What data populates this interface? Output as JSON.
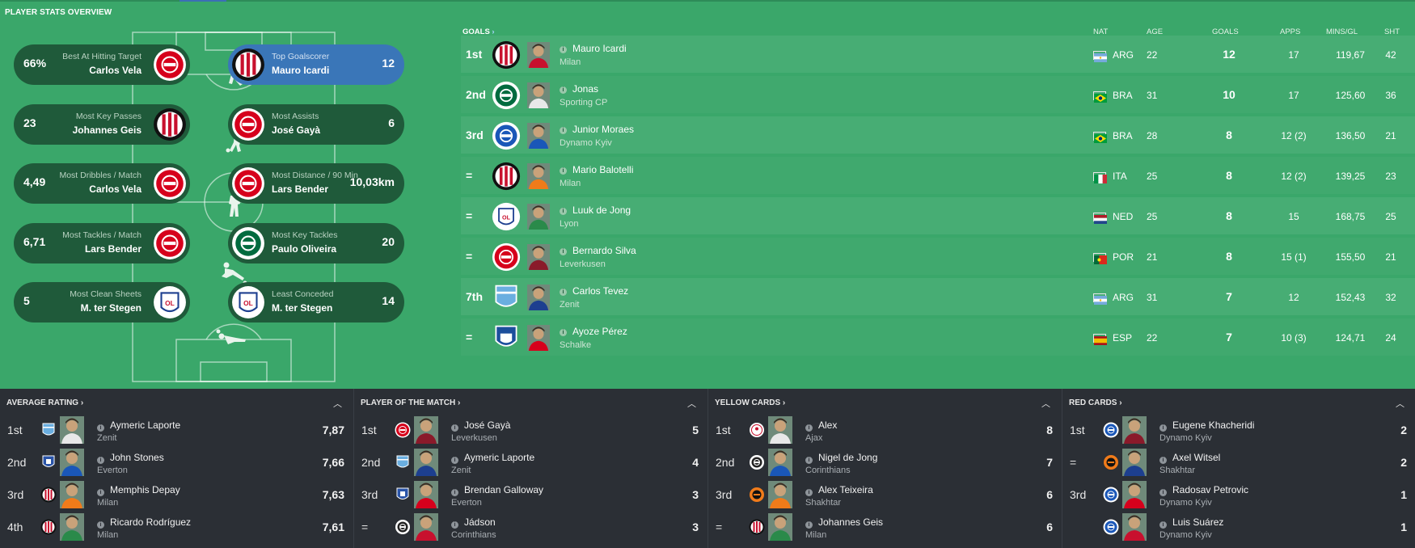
{
  "header": {
    "title": "PLAYER STATS OVERVIEW"
  },
  "stat_cards": [
    {
      "value": "66%",
      "caption": "Best At Hitting Target",
      "player": "Carlos Vela",
      "side": "left",
      "club": "leverkusen"
    },
    {
      "value": "12",
      "caption": "Top Goalscorer",
      "player": "Mauro Icardi",
      "side": "right",
      "club": "milan",
      "highlight": true
    },
    {
      "value": "23",
      "caption": "Most Key Passes",
      "player": "Johannes Geis",
      "side": "left",
      "club": "milan"
    },
    {
      "value": "6",
      "caption": "Most Assists",
      "player": "José Gayà",
      "side": "right",
      "club": "leverkusen"
    },
    {
      "value": "4,49",
      "caption": "Most Dribbles / Match",
      "player": "Carlos Vela",
      "side": "left",
      "club": "leverkusen"
    },
    {
      "value": "10,03km",
      "caption": "Most Distance / 90 Min",
      "player": "Lars Bender",
      "side": "right",
      "club": "leverkusen"
    },
    {
      "value": "6,71",
      "caption": "Most Tackles / Match",
      "player": "Lars Bender",
      "side": "left",
      "club": "leverkusen"
    },
    {
      "value": "20",
      "caption": "Most Key Tackles",
      "player": "Paulo Oliveira",
      "side": "right",
      "club": "sporting"
    },
    {
      "value": "5",
      "caption": "Most Clean Sheets",
      "player": "M. ter Stegen",
      "side": "left",
      "club": "lyon"
    },
    {
      "value": "14",
      "caption": "Least Conceded",
      "player": "M. ter Stegen",
      "side": "right",
      "club": "lyon"
    }
  ],
  "goals_table": {
    "title": "GOALS",
    "columns": {
      "nat": "NAT",
      "age": "AGE",
      "goals": "GOALS",
      "apps": "APPS",
      "mins_gl": "MINS/GL",
      "sht": "SHT"
    },
    "rows": [
      {
        "pos": "1st",
        "name": "Mauro Icardi",
        "club": "Milan",
        "nat": "ARG",
        "age": "22",
        "goals": "12",
        "apps": "17",
        "mins_gl": "119,67",
        "sht": "42",
        "badge": "milan",
        "flag": "arg"
      },
      {
        "pos": "2nd",
        "name": "Jonas",
        "club": "Sporting CP",
        "nat": "BRA",
        "age": "31",
        "goals": "10",
        "apps": "17",
        "mins_gl": "125,60",
        "sht": "36",
        "badge": "sporting",
        "flag": "bra"
      },
      {
        "pos": "3rd",
        "name": "Junior Moraes",
        "club": "Dynamo Kyiv",
        "nat": "BRA",
        "age": "28",
        "goals": "8",
        "apps": "12 (2)",
        "mins_gl": "136,50",
        "sht": "21",
        "badge": "dynamo",
        "flag": "bra"
      },
      {
        "pos": "=",
        "name": "Mario Balotelli",
        "club": "Milan",
        "nat": "ITA",
        "age": "25",
        "goals": "8",
        "apps": "12 (2)",
        "mins_gl": "139,25",
        "sht": "23",
        "badge": "milan",
        "flag": "ita"
      },
      {
        "pos": "=",
        "name": "Luuk de Jong",
        "club": "Lyon",
        "nat": "NED",
        "age": "25",
        "goals": "8",
        "apps": "15",
        "mins_gl": "168,75",
        "sht": "25",
        "badge": "lyon",
        "flag": "ned"
      },
      {
        "pos": "=",
        "name": "Bernardo Silva",
        "club": "Leverkusen",
        "nat": "POR",
        "age": "21",
        "goals": "8",
        "apps": "15 (1)",
        "mins_gl": "155,50",
        "sht": "21",
        "badge": "leverkusen",
        "flag": "por"
      },
      {
        "pos": "7th",
        "name": "Carlos Tevez",
        "club": "Zenit",
        "nat": "ARG",
        "age": "31",
        "goals": "7",
        "apps": "12",
        "mins_gl": "152,43",
        "sht": "32",
        "badge": "zenit",
        "flag": "arg"
      },
      {
        "pos": "=",
        "name": "Ayoze Pérez",
        "club": "Schalke",
        "nat": "ESP",
        "age": "22",
        "goals": "7",
        "apps": "10 (3)",
        "mins_gl": "124,71",
        "sht": "24",
        "badge": "schalke",
        "flag": "esp"
      }
    ]
  },
  "panels": [
    {
      "title": "AVERAGE RATING",
      "rows": [
        {
          "pos": "1st",
          "name": "Aymeric Laporte",
          "club": "Zenit",
          "value": "7,87",
          "badge": "zenit"
        },
        {
          "pos": "2nd",
          "name": "John Stones",
          "club": "Everton",
          "value": "7,66",
          "badge": "everton"
        },
        {
          "pos": "3rd",
          "name": "Memphis Depay",
          "club": "Milan",
          "value": "7,63",
          "badge": "milan"
        },
        {
          "pos": "4th",
          "name": "Ricardo Rodríguez",
          "club": "Milan",
          "value": "7,61",
          "badge": "milan"
        }
      ]
    },
    {
      "title": "PLAYER OF THE MATCH",
      "rows": [
        {
          "pos": "1st",
          "name": "José Gayà",
          "club": "Leverkusen",
          "value": "5",
          "badge": "leverkusen"
        },
        {
          "pos": "2nd",
          "name": "Aymeric Laporte",
          "club": "Zenit",
          "value": "4",
          "badge": "zenit"
        },
        {
          "pos": "3rd",
          "name": "Brendan Galloway",
          "club": "Everton",
          "value": "3",
          "badge": "everton"
        },
        {
          "pos": "=",
          "name": "Jádson",
          "club": "Corinthians",
          "value": "3",
          "badge": "corinthians"
        }
      ]
    },
    {
      "title": "YELLOW CARDS",
      "rows": [
        {
          "pos": "1st",
          "name": "Alex",
          "club": "Ajax",
          "value": "8",
          "badge": "ajax"
        },
        {
          "pos": "2nd",
          "name": "Nigel de Jong",
          "club": "Corinthians",
          "value": "7",
          "badge": "corinthians"
        },
        {
          "pos": "3rd",
          "name": "Alex Teixeira",
          "club": "Shakhtar",
          "value": "6",
          "badge": "shakhtar"
        },
        {
          "pos": "=",
          "name": "Johannes Geis",
          "club": "Milan",
          "value": "6",
          "badge": "milan"
        }
      ]
    },
    {
      "title": "RED CARDS",
      "rows": [
        {
          "pos": "1st",
          "name": "Eugene Khacheridi",
          "club": "Dynamo Kyiv",
          "value": "2",
          "badge": "dynamo"
        },
        {
          "pos": "=",
          "name": "Axel Witsel",
          "club": "Shakhtar",
          "value": "2",
          "badge": "shakhtar"
        },
        {
          "pos": "3rd",
          "name": "Radosav Petrovic",
          "club": "Dynamo Kyiv",
          "value": "1",
          "badge": "dynamo"
        },
        {
          "pos": "",
          "name": "Luis Suárez",
          "club": "Dynamo Kyiv",
          "value": "1",
          "badge": "dynamo"
        }
      ]
    }
  ],
  "colors": {
    "pitch": "#3aa76a",
    "card": "#1f5a3a",
    "highlight": "#3a76b8",
    "bottom": "#2b2f35",
    "milan": "#c8102e",
    "leverkusen": "#d6001c",
    "lyon": "#1d3f8f",
    "sporting": "#006b3f",
    "dynamo": "#1a57b8",
    "zenit": "#6aaee0",
    "schalke": "#1c4f9c",
    "everton": "#2a54a8",
    "corinthians": "#222222",
    "ajax": "#c8102e",
    "shakhtar": "#f07b1a"
  }
}
